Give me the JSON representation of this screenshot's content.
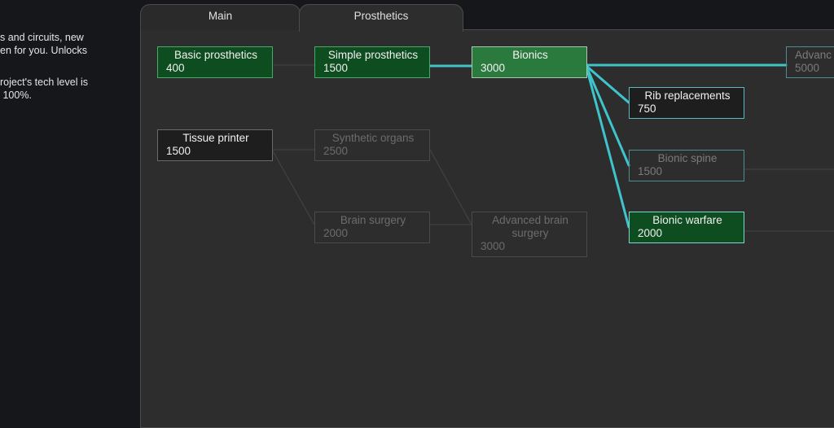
{
  "side_panel": {
    "line1": "s and circuits, new",
    "line2": "en for you. Unlocks",
    "line3": "roject's tech level is",
    "line4": " 100%."
  },
  "tabs": [
    {
      "label": "Main"
    },
    {
      "label": "Prosthetics"
    }
  ],
  "nodes": {
    "basic_prosthetics": {
      "name": "Basic prosthetics",
      "cost": "400"
    },
    "simple_prosthetics": {
      "name": "Simple prosthetics",
      "cost": "1500"
    },
    "bionics": {
      "name": "Bionics",
      "cost": "3000"
    },
    "advanced_cut": {
      "name": "Advanc",
      "cost": "5000"
    },
    "rib_replacements": {
      "name": "Rib replacements",
      "cost": "750"
    },
    "bionic_spine": {
      "name": "Bionic spine",
      "cost": "1500"
    },
    "bionic_warfare": {
      "name": "Bionic warfare",
      "cost": "2000"
    },
    "tissue_printer": {
      "name": "Tissue printer",
      "cost": "1500"
    },
    "synthetic_organs": {
      "name": "Synthetic organs",
      "cost": "2500"
    },
    "brain_surgery": {
      "name": "Brain surgery",
      "cost": "2000"
    },
    "advanced_brain_surgery": {
      "name1": "Advanced brain",
      "name2": "surgery",
      "cost": "3000"
    }
  },
  "colors": {
    "researched": "#0e4d1f",
    "selected": "#2a7a3e",
    "link_active": "#3fc4cc",
    "link_inactive": "#404040"
  }
}
